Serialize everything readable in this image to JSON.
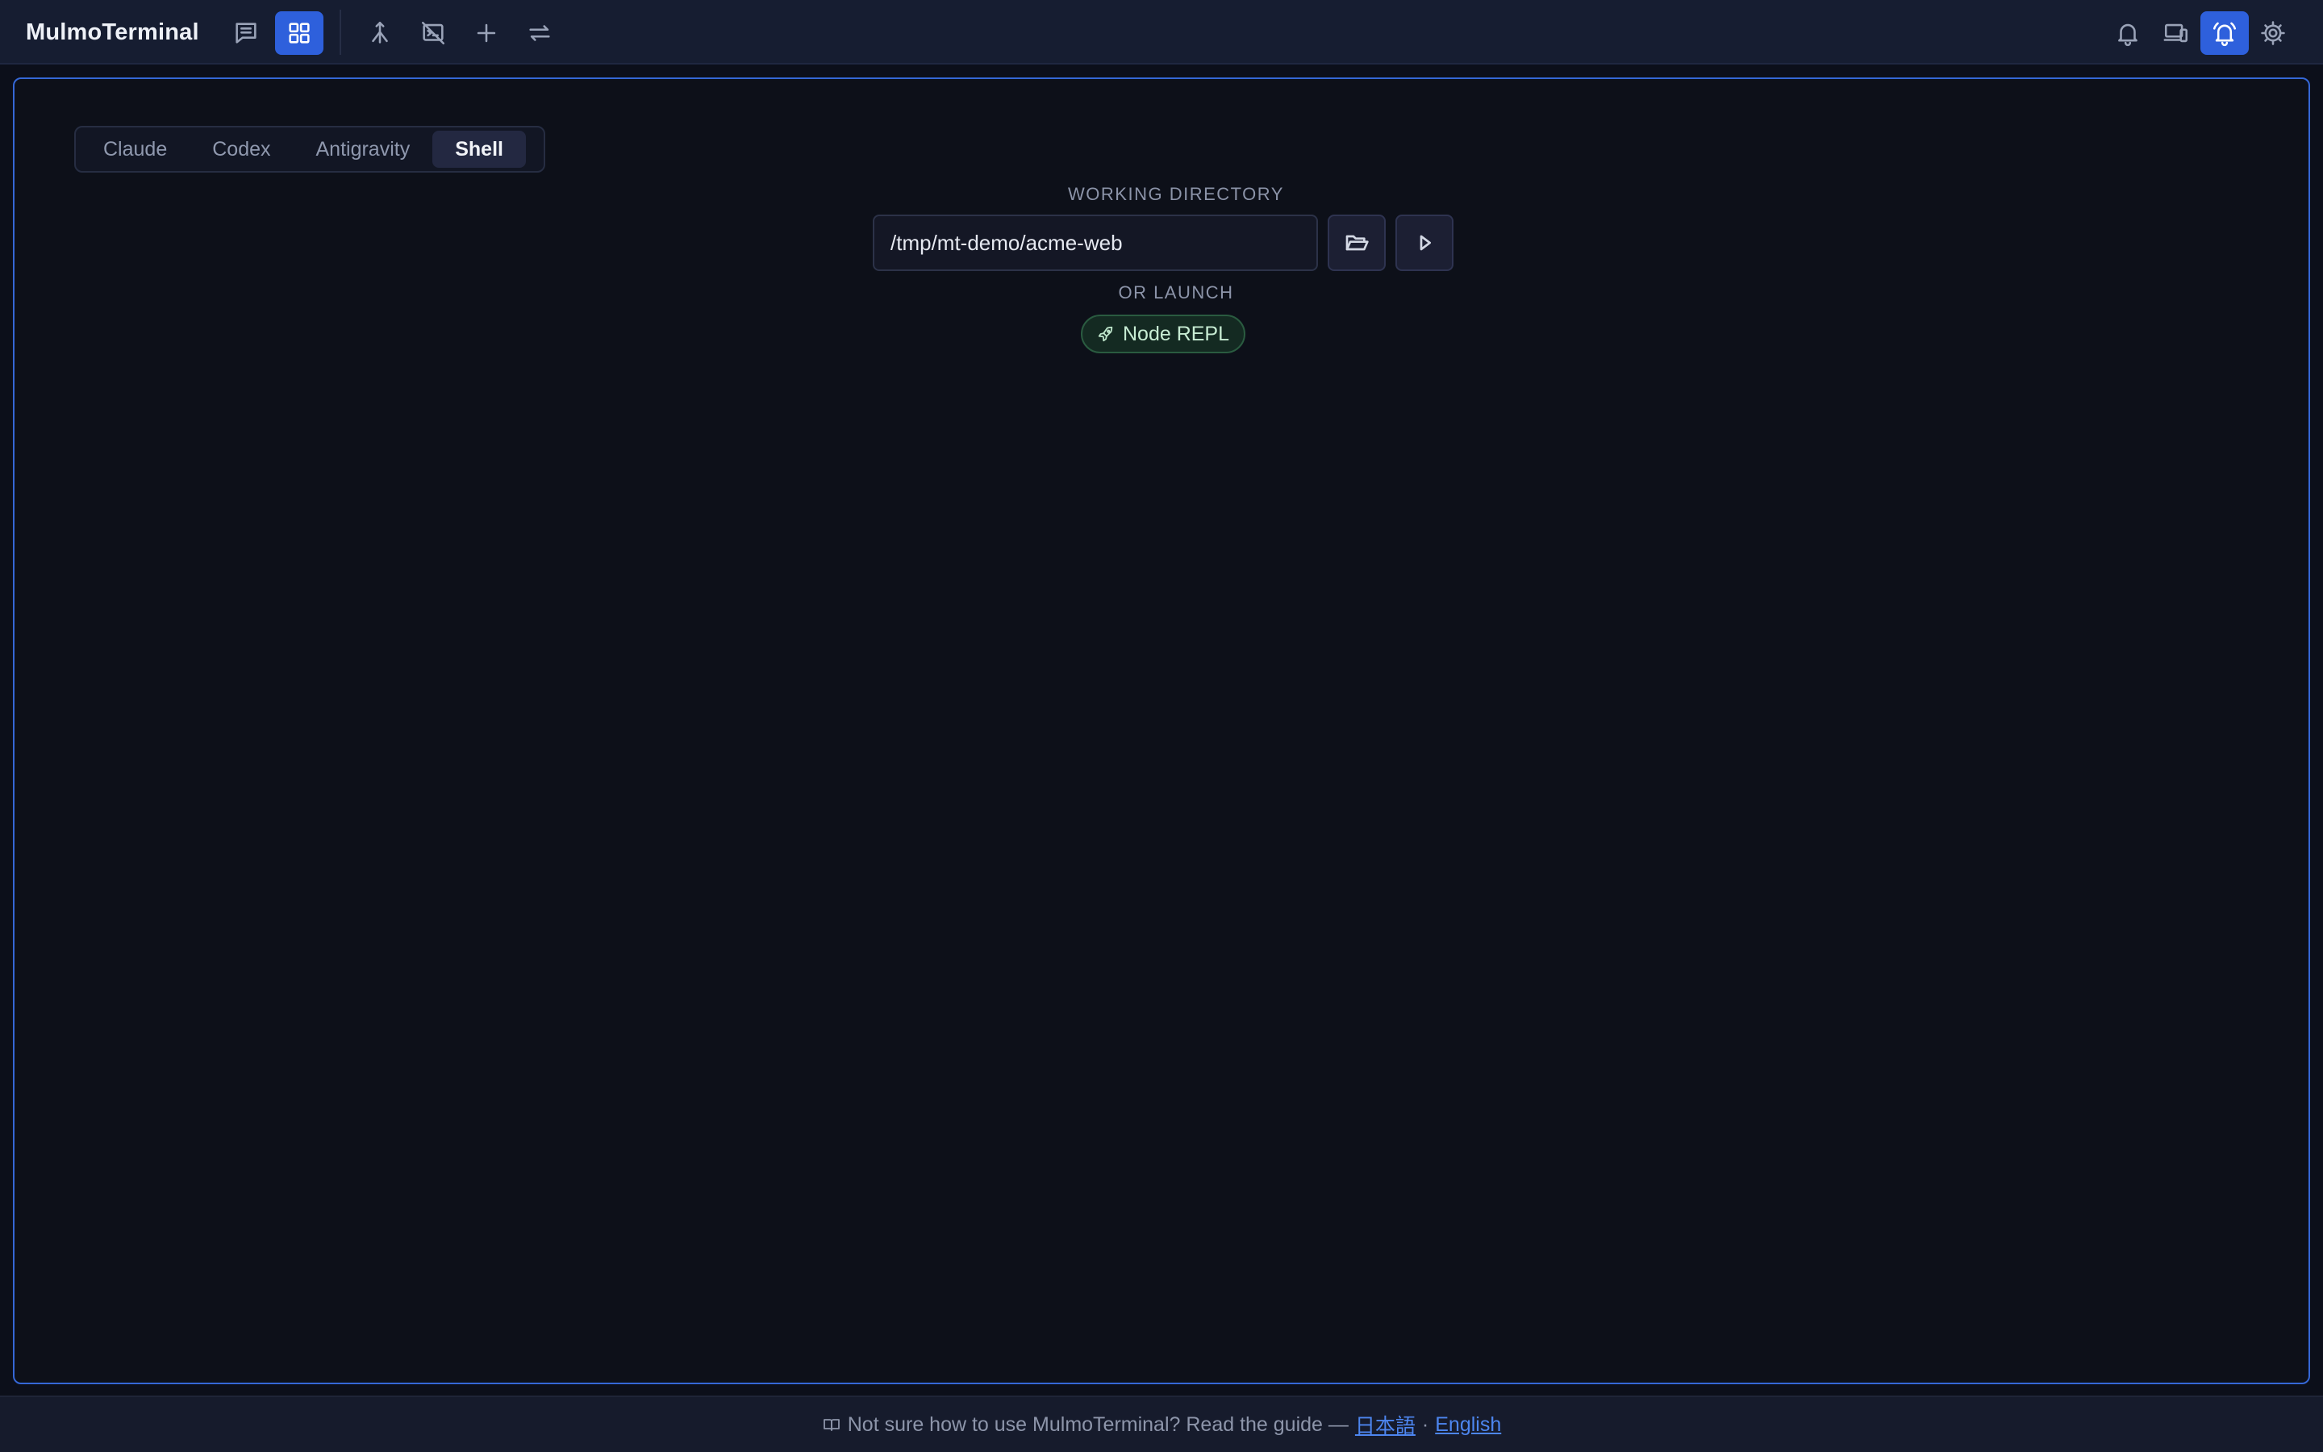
{
  "app": {
    "title": "MulmoTerminal"
  },
  "toolbar": {
    "left_icons": [
      "chat-icon",
      "grid-icon",
      "merge-icon",
      "no-terminal-icon",
      "plus-icon",
      "swap-icon"
    ],
    "right_icons": [
      "bell-icon",
      "devices-icon",
      "bell-ring-icon",
      "gear-icon"
    ],
    "active_left": "grid-icon",
    "active_right": "bell-ring-icon",
    "accent_color": "#2e60dc"
  },
  "tabs": [
    {
      "label": "Claude",
      "active": false
    },
    {
      "label": "Codex",
      "active": false
    },
    {
      "label": "Antigravity",
      "active": false
    },
    {
      "label": "Shell",
      "active": true
    }
  ],
  "working_directory": {
    "label": "WORKING DIRECTORY",
    "value": "/tmp/mt-demo/acme-web",
    "browse_icon": "folder-open-icon",
    "run_icon": "play-icon"
  },
  "launch": {
    "label": "OR LAUNCH",
    "options": [
      {
        "label": "Node REPL",
        "icon": "rocket-icon"
      }
    ]
  },
  "footer": {
    "text": "Not sure how to use MulmoTerminal? Read the guide —",
    "separator": "·",
    "link_ja": "日本語",
    "link_en": "English",
    "icon": "book-icon"
  }
}
